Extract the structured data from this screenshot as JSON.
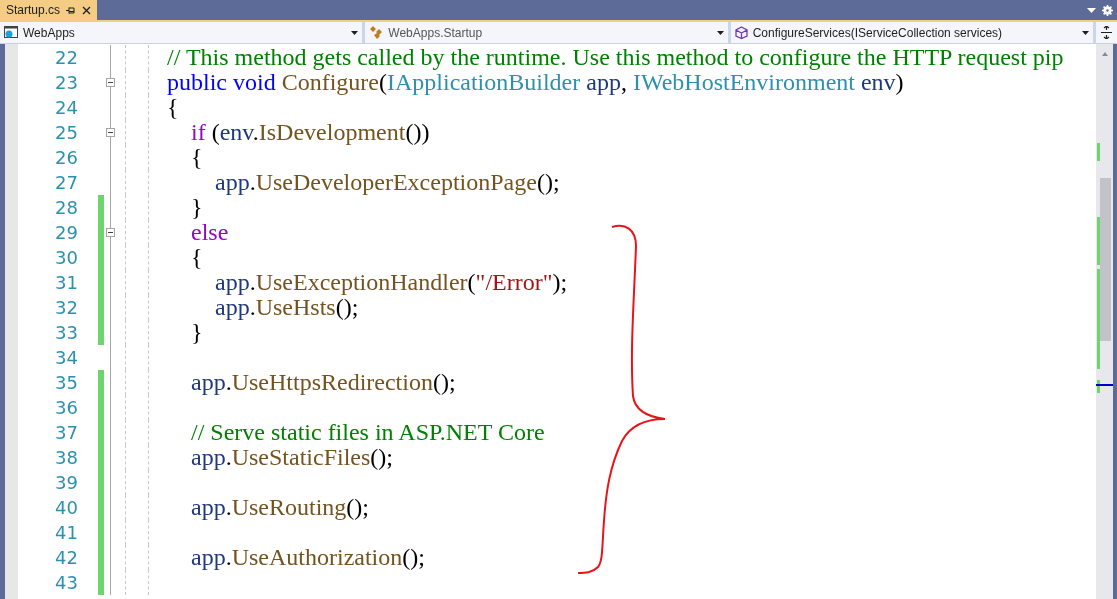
{
  "tab": {
    "title": "Startup.cs",
    "selected": true
  },
  "nav_bar": [
    {
      "kind": "project",
      "label": "WebApps"
    },
    {
      "kind": "class",
      "label": "WebApps.Startup"
    },
    {
      "kind": "method",
      "label": "ConfigureServices(IServiceCollection services)"
    }
  ],
  "lines": [
    {
      "number": "22",
      "changed": false,
      "fold": false,
      "tokens": [
        {
          "kind": "comment",
          "text": "// This method gets called by the runtime. Use this method to configure the HTTP request pip"
        }
      ]
    },
    {
      "number": "23",
      "changed": false,
      "fold": true,
      "tokens": [
        {
          "kind": "keyword",
          "text": "public void "
        },
        {
          "kind": "method",
          "text": "Configure"
        },
        {
          "kind": "plain",
          "text": "("
        },
        {
          "kind": "type",
          "text": "IApplicationBuilder"
        },
        {
          "kind": "variable",
          "text": " app"
        },
        {
          "kind": "plain",
          "text": ", "
        },
        {
          "kind": "type",
          "text": "IWebHostEnvironment"
        },
        {
          "kind": "variable",
          "text": " env"
        },
        {
          "kind": "plain",
          "text": ")"
        }
      ]
    },
    {
      "number": "24",
      "changed": false,
      "fold": false,
      "tokens": [
        {
          "kind": "plain",
          "text": "{"
        }
      ]
    },
    {
      "number": "25",
      "changed": false,
      "fold": true,
      "tokens": [
        {
          "kind": "control",
          "text": "    if"
        },
        {
          "kind": "plain",
          "text": " ("
        },
        {
          "kind": "variable",
          "text": "env"
        },
        {
          "kind": "plain",
          "text": "."
        },
        {
          "kind": "method",
          "text": "IsDevelopment"
        },
        {
          "kind": "plain",
          "text": "())"
        }
      ]
    },
    {
      "number": "26",
      "changed": false,
      "fold": false,
      "tokens": [
        {
          "kind": "plain",
          "text": "    {"
        }
      ]
    },
    {
      "number": "27",
      "changed": false,
      "fold": false,
      "tokens": [
        {
          "kind": "variable",
          "text": "        app"
        },
        {
          "kind": "plain",
          "text": "."
        },
        {
          "kind": "method",
          "text": "UseDeveloperExceptionPage"
        },
        {
          "kind": "plain",
          "text": "();"
        }
      ]
    },
    {
      "number": "28",
      "changed": true,
      "fold": false,
      "tokens": [
        {
          "kind": "plain",
          "text": "    }"
        }
      ]
    },
    {
      "number": "29",
      "changed": true,
      "fold": true,
      "tokens": [
        {
          "kind": "control",
          "text": "    else"
        }
      ]
    },
    {
      "number": "30",
      "changed": true,
      "fold": false,
      "tokens": [
        {
          "kind": "plain",
          "text": "    {"
        }
      ]
    },
    {
      "number": "31",
      "changed": true,
      "fold": false,
      "tokens": [
        {
          "kind": "variable",
          "text": "        app"
        },
        {
          "kind": "plain",
          "text": "."
        },
        {
          "kind": "method",
          "text": "UseExceptionHandler"
        },
        {
          "kind": "plain",
          "text": "("
        },
        {
          "kind": "string",
          "text": "\"/Error\""
        },
        {
          "kind": "plain",
          "text": ");"
        }
      ]
    },
    {
      "number": "32",
      "changed": true,
      "fold": false,
      "tokens": [
        {
          "kind": "variable",
          "text": "        app"
        },
        {
          "kind": "plain",
          "text": "."
        },
        {
          "kind": "method",
          "text": "UseHsts"
        },
        {
          "kind": "plain",
          "text": "();"
        }
      ]
    },
    {
      "number": "33",
      "changed": true,
      "fold": false,
      "tokens": [
        {
          "kind": "plain",
          "text": "    }"
        }
      ]
    },
    {
      "number": "34",
      "changed": false,
      "fold": false
    },
    {
      "number": "35",
      "changed": true,
      "fold": false,
      "tokens": [
        {
          "kind": "variable",
          "text": "    app"
        },
        {
          "kind": "plain",
          "text": "."
        },
        {
          "kind": "method",
          "text": "UseHttpsRedirection"
        },
        {
          "kind": "plain",
          "text": "();"
        }
      ]
    },
    {
      "number": "36",
      "changed": true,
      "fold": false
    },
    {
      "number": "37",
      "changed": true,
      "fold": false,
      "tokens": [
        {
          "kind": "comment",
          "text": "    // Serve static files in ASP.NET Core"
        }
      ]
    },
    {
      "number": "38",
      "changed": true,
      "fold": false,
      "tokens": [
        {
          "kind": "variable",
          "text": "    app"
        },
        {
          "kind": "plain",
          "text": "."
        },
        {
          "kind": "method",
          "text": "UseStaticFiles"
        },
        {
          "kind": "plain",
          "text": "();"
        }
      ]
    },
    {
      "number": "39",
      "changed": true,
      "fold": false
    },
    {
      "number": "40",
      "changed": true,
      "fold": false,
      "tokens": [
        {
          "kind": "variable",
          "text": "    app"
        },
        {
          "kind": "plain",
          "text": "."
        },
        {
          "kind": "method",
          "text": "UseRouting"
        },
        {
          "kind": "plain",
          "text": "();"
        }
      ]
    },
    {
      "number": "41",
      "changed": true,
      "fold": false
    },
    {
      "number": "42",
      "changed": true,
      "fold": false,
      "tokens": [
        {
          "kind": "variable",
          "text": "    app"
        },
        {
          "kind": "plain",
          "text": "."
        },
        {
          "kind": "method",
          "text": "UseAuthorization"
        },
        {
          "kind": "plain",
          "text": "();"
        }
      ]
    },
    {
      "number": "43",
      "changed": true,
      "fold": false
    }
  ]
}
